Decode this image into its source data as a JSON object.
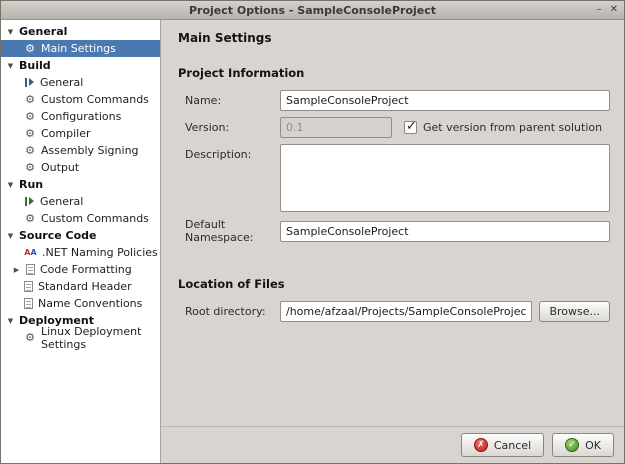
{
  "window": {
    "title": "Project Options - SampleConsoleProject",
    "controls": {
      "minimize_glyph": "–",
      "close_glyph": "✕"
    }
  },
  "sidebar": {
    "sections": [
      {
        "label": "General",
        "items": [
          {
            "label": "Main Settings",
            "icon": "gear-icon",
            "selected": true
          }
        ]
      },
      {
        "label": "Build",
        "items": [
          {
            "label": "General",
            "icon": "build-icon"
          },
          {
            "label": "Custom Commands",
            "icon": "gear-icon"
          },
          {
            "label": "Configurations",
            "icon": "gear-icon"
          },
          {
            "label": "Compiler",
            "icon": "gear-icon"
          },
          {
            "label": "Assembly Signing",
            "icon": "gear-icon"
          },
          {
            "label": "Output",
            "icon": "gear-icon"
          }
        ]
      },
      {
        "label": "Run",
        "items": [
          {
            "label": "General",
            "icon": "run-icon"
          },
          {
            "label": "Custom Commands",
            "icon": "gear-icon"
          }
        ]
      },
      {
        "label": "Source Code",
        "items": [
          {
            "label": ".NET Naming Policies",
            "icon": "naming-policies-icon"
          },
          {
            "label": "Code Formatting",
            "icon": "document-icon",
            "expandable": true
          },
          {
            "label": "Standard Header",
            "icon": "document-icon"
          },
          {
            "label": "Name Conventions",
            "icon": "document-icon"
          }
        ]
      },
      {
        "label": "Deployment",
        "items": [
          {
            "label": "Linux Deployment Settings",
            "icon": "gear-icon"
          }
        ]
      }
    ]
  },
  "main": {
    "title": "Main Settings",
    "project_information": {
      "heading": "Project Information",
      "name": {
        "label": "Name:",
        "value": "SampleConsoleProject"
      },
      "version": {
        "label": "Version:",
        "value": "0.1",
        "disabled": true,
        "checkbox_label": "Get version from parent solution",
        "checkbox_checked": true
      },
      "description": {
        "label": "Description:",
        "value": ""
      },
      "default_namespace": {
        "label": "Default Namespace:",
        "value": "SampleConsoleProject"
      }
    },
    "location_of_files": {
      "heading": "Location of Files",
      "root_directory": {
        "label": "Root directory:",
        "value": "/home/afzaal/Projects/SampleConsoleProject/SampleConsoleProject"
      },
      "browse_label": "Browse..."
    }
  },
  "footer": {
    "cancel_label": "Cancel",
    "ok_label": "OK"
  }
}
